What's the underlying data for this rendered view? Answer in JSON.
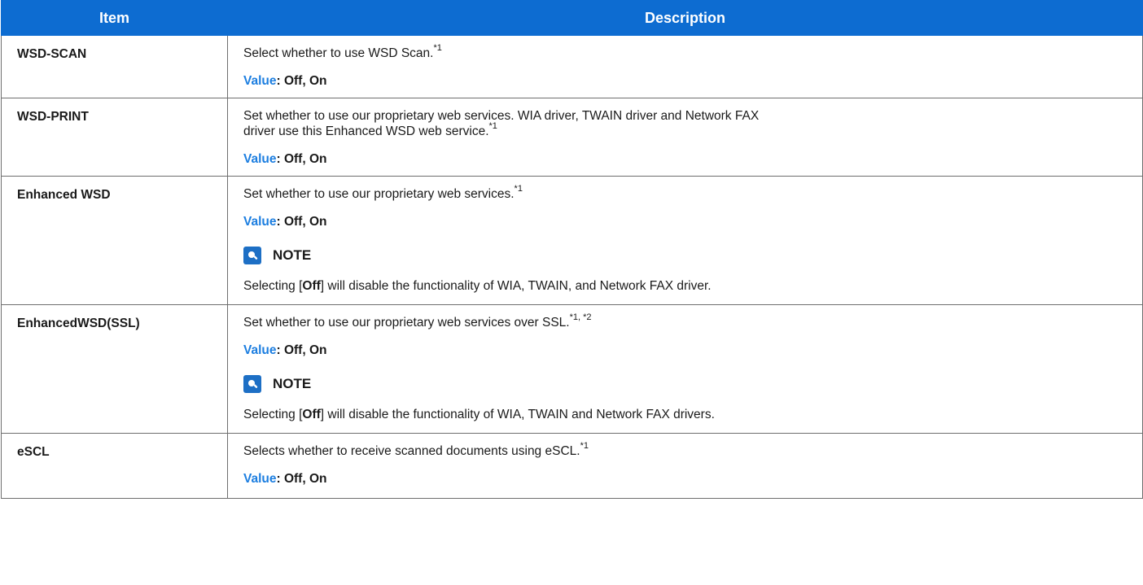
{
  "header": {
    "item": "Item",
    "description": "Description"
  },
  "rows": [
    {
      "item": "WSD-SCAN",
      "desc": "Select whether to use WSD Scan.",
      "sup": "*1",
      "value_label": "Value",
      "value_text": ": Off, On"
    },
    {
      "item": "WSD-PRINT",
      "desc_line1": "Set whether to use our proprietary web services. WIA driver, TWAIN driver and Network FAX",
      "desc_line2": "driver use this Enhanced WSD web service.",
      "sup": "*1",
      "value_label": "Value",
      "value_text": ": Off, On"
    },
    {
      "item": "Enhanced WSD",
      "desc": "Set whether to use our proprietary web services.",
      "sup": "*1",
      "value_label": "Value",
      "value_text": ": Off, On",
      "note_title": "NOTE",
      "note_before": "Selecting [",
      "note_bold": "Off",
      "note_after": "] will disable the functionality of WIA, TWAIN, and Network FAX driver."
    },
    {
      "item": "EnhancedWSD(SSL)",
      "desc": "Set whether to use our proprietary web services over SSL.",
      "sup": "*1, *2",
      "value_label": "Value",
      "value_text": ": Off, On",
      "note_title": "NOTE",
      "note_before": "Selecting [",
      "note_bold": "Off",
      "note_after": "] will disable the functionality of WIA, TWAIN and Network FAX drivers."
    },
    {
      "item": "eSCL",
      "desc": "Selects whether to receive scanned documents using eSCL.",
      "sup": "*1",
      "value_label": "Value",
      "value_text": ": Off, On"
    }
  ],
  "icons": {
    "note": "note-lightbulb-icon"
  },
  "colors": {
    "header_bg": "#0d6cd1",
    "value_label": "#1c7ee0"
  }
}
